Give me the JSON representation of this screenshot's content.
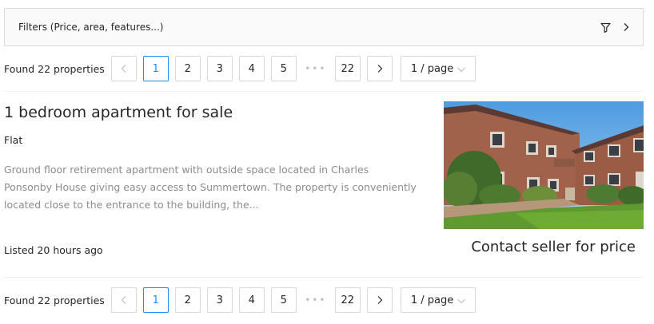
{
  "filters": {
    "label": "Filters (Price, area, features...)",
    "icon": "filter-funnel-icon",
    "expand_icon": "chevron-right-icon"
  },
  "pagination": {
    "found_text": "Found 22 properties",
    "pages": [
      "1",
      "2",
      "3",
      "4",
      "5"
    ],
    "ellipsis": "•••",
    "last_page": "22",
    "current_page": 1,
    "page_size": "1 / page"
  },
  "listing": {
    "title": "1 bedroom apartment for sale",
    "type": "Flat",
    "description": "Ground floor retirement apartment with outside space located in Charles Ponsonby House giving easy access to Summertown. The property is conveniently located close to the entrance to the building, the...",
    "listed": "Listed 20 hours ago",
    "price": "Contact seller for price"
  },
  "colors": {
    "accent": "#1890ff",
    "border": "#d9d9d9",
    "muted": "#8c8c8c"
  }
}
